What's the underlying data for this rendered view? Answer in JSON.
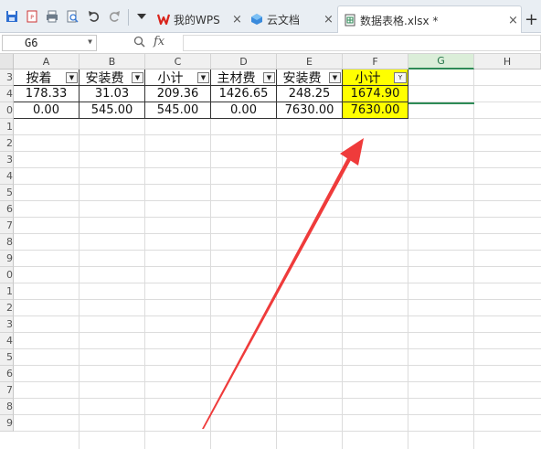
{
  "tabs": [
    {
      "label": "我的WPS",
      "close": "×",
      "icon": "wps-logo-icon"
    },
    {
      "label": "云文档",
      "close": "×",
      "icon": "cloud-doc-icon"
    },
    {
      "label": "数据表格.xlsx *",
      "close": "×",
      "icon": "spreadsheet-icon"
    }
  ],
  "new_tab": "+",
  "formula_bar": {
    "cell_ref": "G6",
    "fx": "fx",
    "value": ""
  },
  "columns": [
    "A",
    "B",
    "C",
    "D",
    "E",
    "F",
    "G",
    "H"
  ],
  "selected_column": "G",
  "row_numbers": [
    "3",
    "4",
    "0",
    "1",
    "2",
    "3",
    "4",
    "5",
    "6",
    "7",
    "8",
    "9",
    "0",
    "1",
    "2",
    "3",
    "4",
    "5",
    "6",
    "7",
    "8",
    "9"
  ],
  "table": {
    "headers": [
      "按着",
      "安装费",
      "小计",
      "主材费",
      "安装费",
      "小计"
    ],
    "rows": [
      [
        "178.33",
        "31.03",
        "209.36",
        "1426.65",
        "248.25",
        "1674.90"
      ],
      [
        "0.00",
        "545.00",
        "545.00",
        "0.00",
        "7630.00",
        "7630.00"
      ]
    ],
    "highlight_color": "#ffff00"
  },
  "annotation": {
    "type": "red-arrow",
    "color": "#ef3b3b"
  },
  "accent": "#2e8b57"
}
